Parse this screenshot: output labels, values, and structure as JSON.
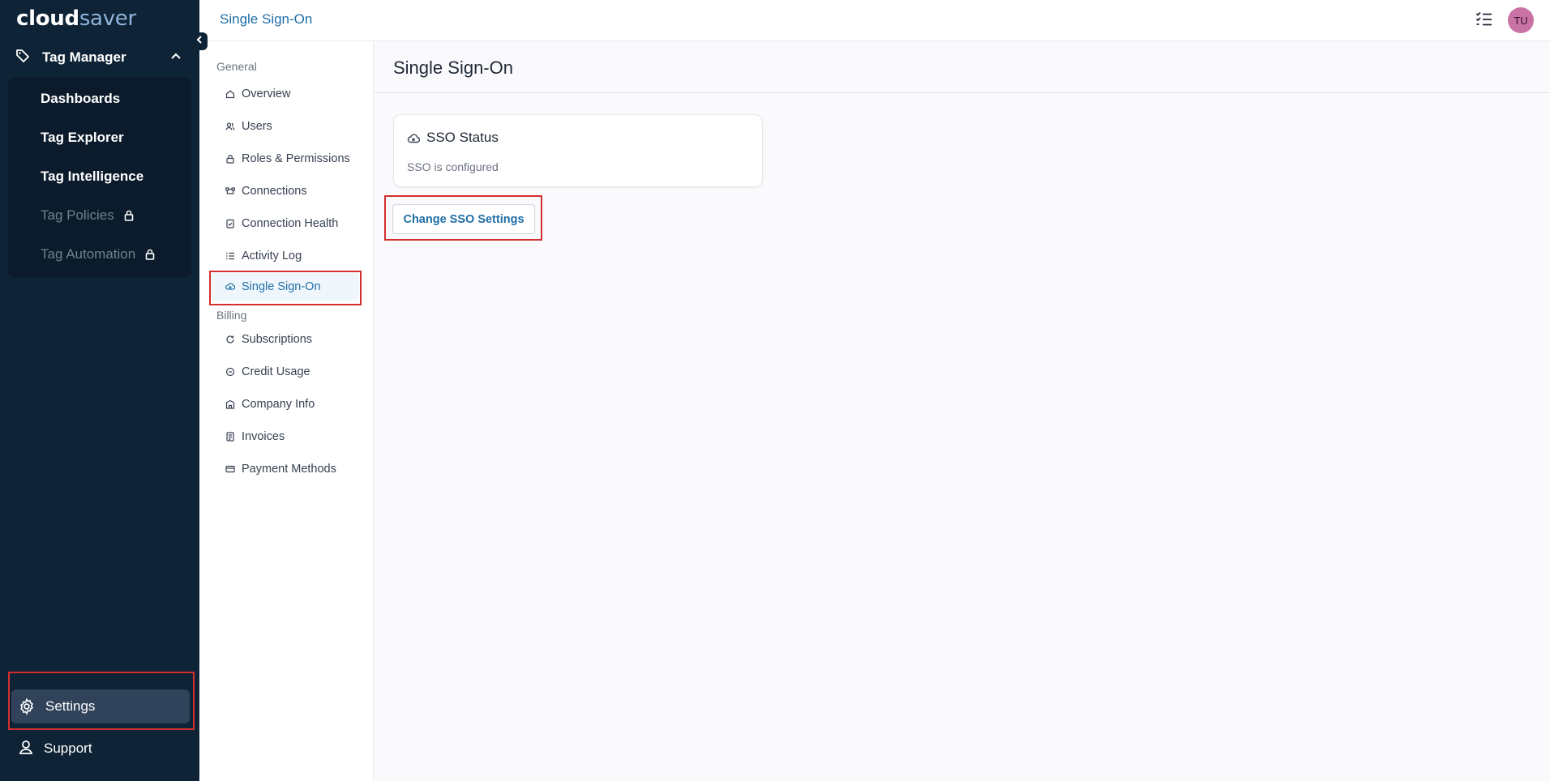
{
  "brand": {
    "logo_part1": "cloud",
    "logo_part2": "saver"
  },
  "sidebar": {
    "group_label": "Tag Manager",
    "items": [
      {
        "label": "Dashboards",
        "locked": false
      },
      {
        "label": "Tag Explorer",
        "locked": false
      },
      {
        "label": "Tag Intelligence",
        "locked": false
      },
      {
        "label": "Tag Policies",
        "locked": true
      },
      {
        "label": "Tag Automation",
        "locked": true
      }
    ],
    "settings_label": "Settings",
    "support_label": "Support"
  },
  "header": {
    "title": "Single Sign-On",
    "avatar_initials": "TU"
  },
  "settings_nav": {
    "general_label": "General",
    "general_items": [
      "Overview",
      "Users",
      "Roles & Permissions",
      "Connections",
      "Connection Health",
      "Activity Log",
      "Single Sign-On"
    ],
    "billing_label": "Billing",
    "billing_items": [
      "Subscriptions",
      "Credit Usage",
      "Company Info",
      "Invoices",
      "Payment Methods"
    ],
    "active": "Single Sign-On"
  },
  "main": {
    "heading": "Single Sign-On",
    "card_title": "SSO Status",
    "card_status": "SSO is configured",
    "button_label": "Change SSO Settings"
  },
  "colors": {
    "sidebar_bg": "#0f2336",
    "accent": "#1f6ea6",
    "highlight_border": "#d32f2f",
    "avatar_bg": "#c873a4"
  }
}
